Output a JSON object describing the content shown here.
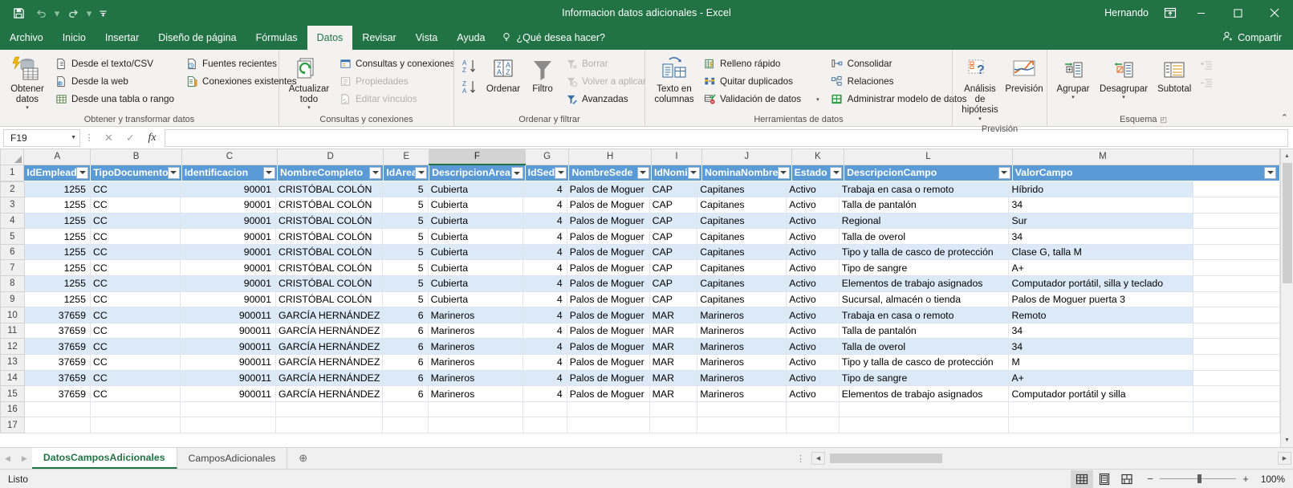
{
  "titlebar": {
    "document_title": "Informacion datos adicionales  -  Excel",
    "user_name": "Hernando",
    "qat": [
      {
        "name": "save-icon",
        "label": "Guardar"
      },
      {
        "name": "undo-icon",
        "label": "Deshacer"
      },
      {
        "name": "redo-icon",
        "label": "Rehacer"
      },
      {
        "name": "customize-qat-icon",
        "label": "Personalizar barra de herramientas de acceso rápido"
      }
    ],
    "ribbon_display_options": "Opciones de presentación de la cinta de opciones",
    "minimize": "—",
    "maximize": "▢",
    "close": "✕"
  },
  "ribbon_tabs": {
    "items": [
      {
        "label": "Archivo",
        "active": false
      },
      {
        "label": "Inicio",
        "active": false
      },
      {
        "label": "Insertar",
        "active": false
      },
      {
        "label": "Diseño de página",
        "active": false
      },
      {
        "label": "Fórmulas",
        "active": false
      },
      {
        "label": "Datos",
        "active": true
      },
      {
        "label": "Revisar",
        "active": false
      },
      {
        "label": "Vista",
        "active": false
      },
      {
        "label": "Ayuda",
        "active": false
      }
    ],
    "tell_me": "¿Qué desea hacer?",
    "share": "Compartir"
  },
  "ribbon": {
    "groups": [
      {
        "title": "Obtener y transformar datos",
        "big": {
          "label": "Obtener\ndatos",
          "icon": "get-data-icon",
          "caret": "▾"
        },
        "small": [
          {
            "label": "Desde el texto/CSV",
            "icon": "text-csv-icon",
            "disabled": false
          },
          {
            "label": "Desde la web",
            "icon": "from-web-icon",
            "disabled": false
          },
          {
            "label": "Desde una tabla o rango",
            "icon": "from-table-icon",
            "disabled": false
          }
        ],
        "small2": [
          {
            "label": "Fuentes recientes",
            "icon": "recent-sources-icon",
            "disabled": false
          },
          {
            "label": "Conexiones existentes",
            "icon": "existing-connections-icon",
            "disabled": false
          }
        ]
      },
      {
        "title": "Consultas y conexiones",
        "big": {
          "label": "Actualizar\ntodo",
          "icon": "refresh-all-icon",
          "caret": "▾"
        },
        "small": [
          {
            "label": "Consultas y conexiones",
            "icon": "queries-connections-icon",
            "disabled": false
          },
          {
            "label": "Propiedades",
            "icon": "properties-icon",
            "disabled": true
          },
          {
            "label": "Editar vínculos",
            "icon": "edit-links-icon",
            "disabled": true
          }
        ]
      },
      {
        "title": "Ordenar y filtrar",
        "sort_az": {
          "label": "Ordenar de A a Z",
          "icon": "sort-az-icon"
        },
        "sort_za": {
          "label": "Ordenar de Z a A",
          "icon": "sort-za-icon"
        },
        "sort_big": {
          "label": "Ordenar",
          "icon": "sort-dialog-icon"
        },
        "filter_big": {
          "label": "Filtro",
          "icon": "filter-icon"
        },
        "small": [
          {
            "label": "Borrar",
            "icon": "clear-filter-icon",
            "disabled": true
          },
          {
            "label": "Volver a aplicar",
            "icon": "reapply-icon",
            "disabled": true
          },
          {
            "label": "Avanzadas",
            "icon": "advanced-filter-icon",
            "disabled": false
          }
        ]
      },
      {
        "title": "Herramientas de datos",
        "big": {
          "label": "Texto en\ncolumnas",
          "icon": "text-to-columns-icon",
          "caret": ""
        },
        "small": [
          {
            "label": "Relleno rápido",
            "icon": "flash-fill-icon",
            "disabled": false
          },
          {
            "label": "Quitar duplicados",
            "icon": "remove-duplicates-icon",
            "disabled": false
          },
          {
            "label": "Validación de datos",
            "icon": "data-validation-icon",
            "disabled": false,
            "caret": "▾"
          }
        ],
        "small2": [
          {
            "label": "Consolidar",
            "icon": "consolidate-icon",
            "disabled": false
          },
          {
            "label": "Relaciones",
            "icon": "relationships-icon",
            "disabled": false
          },
          {
            "label": "Administrar modelo de datos",
            "icon": "manage-data-model-icon",
            "disabled": false
          }
        ]
      },
      {
        "title": "Previsión",
        "big": [
          {
            "label": "Análisis de\nhipótesis",
            "icon": "what-if-analysis-icon",
            "caret": "▾"
          },
          {
            "label": "Previsión",
            "icon": "forecast-sheet-icon",
            "caret": ""
          }
        ]
      },
      {
        "title": "Esquema",
        "big": [
          {
            "label": "Agrupar",
            "icon": "group-icon",
            "caret": "▾"
          },
          {
            "label": "Desagrupar",
            "icon": "ungroup-icon",
            "caret": "▾"
          },
          {
            "label": "Subtotal",
            "icon": "subtotal-icon",
            "caret": ""
          }
        ],
        "small": [
          {
            "label": "Mostrar detalle",
            "icon": "show-detail-icon",
            "disabled": true
          },
          {
            "label": "Ocultar detalle",
            "icon": "hide-detail-icon",
            "disabled": true
          }
        ],
        "dialog_launcher": "◰"
      }
    ],
    "collapse": "⌃"
  },
  "formula_bar": {
    "name_box_value": "F19",
    "cancel": "✕",
    "enter": "✓",
    "insert_function": "fx",
    "formula_value": ""
  },
  "grid": {
    "column_letters": [
      "A",
      "B",
      "C",
      "D",
      "E",
      "F",
      "G",
      "H",
      "I",
      "J",
      "K",
      "L",
      "M"
    ],
    "selected_column": "F",
    "headers": [
      "IdEmpleado",
      "TipoDocumento",
      "Identificacion",
      "NombreCompleto",
      "IdArea",
      "DescripcionArea",
      "IdSede",
      "NombreSede",
      "IdNomina",
      "NominaNombre",
      "Estado",
      "DescripcionCampo",
      "ValorCampo"
    ],
    "header_row_number": "1",
    "rows": [
      {
        "n": "2",
        "cells": [
          "1255",
          "CC",
          "90001",
          "CRISTÓBAL COLÓN",
          "5",
          "Cubierta",
          "4",
          "Palos de Moguer",
          "CAP",
          "Capitanes",
          "Activo",
          "Trabaja en casa o remoto",
          "Híbrido"
        ]
      },
      {
        "n": "3",
        "cells": [
          "1255",
          "CC",
          "90001",
          "CRISTÓBAL COLÓN",
          "5",
          "Cubierta",
          "4",
          "Palos de Moguer",
          "CAP",
          "Capitanes",
          "Activo",
          "Talla de pantalón",
          "34"
        ]
      },
      {
        "n": "4",
        "cells": [
          "1255",
          "CC",
          "90001",
          "CRISTÓBAL COLÓN",
          "5",
          "Cubierta",
          "4",
          "Palos de Moguer",
          "CAP",
          "Capitanes",
          "Activo",
          "Regional",
          "Sur"
        ]
      },
      {
        "n": "5",
        "cells": [
          "1255",
          "CC",
          "90001",
          "CRISTÓBAL COLÓN",
          "5",
          "Cubierta",
          "4",
          "Palos de Moguer",
          "CAP",
          "Capitanes",
          "Activo",
          "Talla de overol",
          "34"
        ]
      },
      {
        "n": "6",
        "cells": [
          "1255",
          "CC",
          "90001",
          "CRISTÓBAL COLÓN",
          "5",
          "Cubierta",
          "4",
          "Palos de Moguer",
          "CAP",
          "Capitanes",
          "Activo",
          "Tipo y talla de casco de protección",
          "Clase G, talla M"
        ]
      },
      {
        "n": "7",
        "cells": [
          "1255",
          "CC",
          "90001",
          "CRISTÓBAL COLÓN",
          "5",
          "Cubierta",
          "4",
          "Palos de Moguer",
          "CAP",
          "Capitanes",
          "Activo",
          "Tipo de sangre",
          "A+"
        ]
      },
      {
        "n": "8",
        "cells": [
          "1255",
          "CC",
          "90001",
          "CRISTÓBAL COLÓN",
          "5",
          "Cubierta",
          "4",
          "Palos de Moguer",
          "CAP",
          "Capitanes",
          "Activo",
          "Elementos de trabajo asignados",
          "Computador portátil, silla y teclado"
        ]
      },
      {
        "n": "9",
        "cells": [
          "1255",
          "CC",
          "90001",
          "CRISTÓBAL COLÓN",
          "5",
          "Cubierta",
          "4",
          "Palos de Moguer",
          "CAP",
          "Capitanes",
          "Activo",
          "Sucursal, almacén o tienda",
          "Palos de Moguer puerta 3"
        ]
      },
      {
        "n": "10",
        "cells": [
          "37659",
          "CC",
          "900011",
          "GARCÍA HERNÁNDEZ",
          "6",
          "Marineros",
          "4",
          "Palos de Moguer",
          "MAR",
          "Marineros",
          "Activo",
          "Trabaja en casa o remoto",
          "Remoto"
        ]
      },
      {
        "n": "11",
        "cells": [
          "37659",
          "CC",
          "900011",
          "GARCÍA HERNÁNDEZ",
          "6",
          "Marineros",
          "4",
          "Palos de Moguer",
          "MAR",
          "Marineros",
          "Activo",
          "Talla de pantalón",
          "34"
        ]
      },
      {
        "n": "12",
        "cells": [
          "37659",
          "CC",
          "900011",
          "GARCÍA HERNÁNDEZ",
          "6",
          "Marineros",
          "4",
          "Palos de Moguer",
          "MAR",
          "Marineros",
          "Activo",
          "Talla de overol",
          "34"
        ]
      },
      {
        "n": "13",
        "cells": [
          "37659",
          "CC",
          "900011",
          "GARCÍA HERNÁNDEZ",
          "6",
          "Marineros",
          "4",
          "Palos de Moguer",
          "MAR",
          "Marineros",
          "Activo",
          "Tipo y talla de casco de protección",
          "M"
        ]
      },
      {
        "n": "14",
        "cells": [
          "37659",
          "CC",
          "900011",
          "GARCÍA HERNÁNDEZ",
          "6",
          "Marineros",
          "4",
          "Palos de Moguer",
          "MAR",
          "Marineros",
          "Activo",
          "Tipo de sangre",
          "A+"
        ]
      },
      {
        "n": "15",
        "cells": [
          "37659",
          "CC",
          "900011",
          "GARCÍA HERNÁNDEZ",
          "6",
          "Marineros",
          "4",
          "Palos de Moguer",
          "MAR",
          "Marineros",
          "Activo",
          "Elementos de trabajo asignados",
          "Computador portátil y silla"
        ]
      },
      {
        "n": "16",
        "cells": [
          "",
          "",
          "",
          "",
          "",
          "",
          "",
          "",
          "",
          "",
          "",
          "",
          ""
        ]
      },
      {
        "n": "17",
        "cells": [
          "",
          "",
          "",
          "",
          "",
          "",
          "",
          "",
          "",
          "",
          "",
          "",
          ""
        ]
      }
    ]
  },
  "sheet_tabs": {
    "prev": "◀",
    "next": "▶",
    "items": [
      {
        "label": "DatosCamposAdicionales",
        "active": true
      },
      {
        "label": "CamposAdicionales",
        "active": false
      }
    ],
    "add_sheet": "⊕"
  },
  "statusbar": {
    "status": "Listo",
    "views": [
      {
        "name": "normal-view-icon",
        "label": "Normal",
        "active": true
      },
      {
        "name": "page-layout-view-icon",
        "label": "Diseño de página",
        "active": false
      },
      {
        "name": "page-break-view-icon",
        "label": "Vista previa de salto de página",
        "active": false
      }
    ],
    "zoom_out": "−",
    "zoom_in": "+",
    "zoom_level": "100%"
  },
  "colors": {
    "brand_green": "#217346",
    "table_header_blue": "#5b9bd5",
    "band_blue": "#dce9f7"
  }
}
